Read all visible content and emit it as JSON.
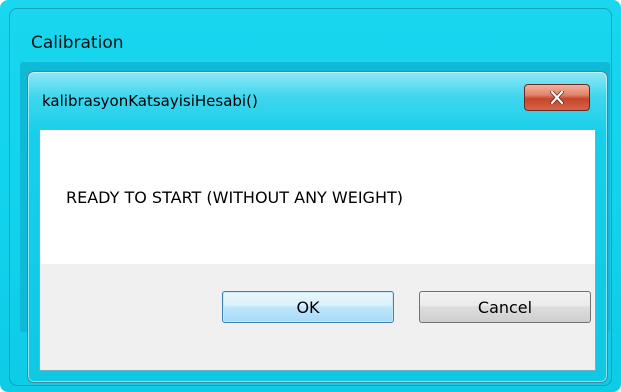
{
  "parent_window": {
    "title": "Calibration"
  },
  "dialog": {
    "title": "kalibrasyonKatsayisiHesabi()",
    "message": "READY TO START (WITHOUT ANY WEIGHT)",
    "ok_label": "OK",
    "cancel_label": "Cancel",
    "close_icon": "close-x-icon"
  },
  "colors": {
    "frame_accent": "#12d3ed",
    "close_button": "#c8452b",
    "ok_border": "#3c7fb1"
  }
}
